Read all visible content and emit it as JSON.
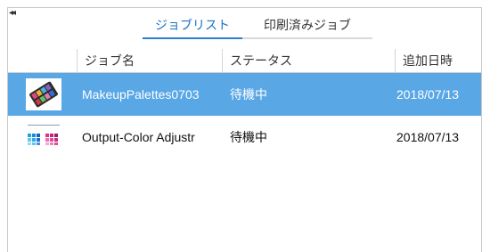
{
  "panel": {
    "collapse_glyph": "◂◂"
  },
  "tabs": [
    {
      "label": "ジョブリスト",
      "active": true
    },
    {
      "label": "印刷済みジョブ",
      "active": false
    }
  ],
  "table": {
    "columns": [
      "",
      "ジョブ名",
      "ステータス",
      "追加日時"
    ],
    "rows": [
      {
        "thumbnail_icon": "makeup-palette-thumbnail",
        "name": "MakeupPalettes0703",
        "status": "待機中",
        "added": "2018/07/13",
        "selected": true
      },
      {
        "thumbnail_icon": "color-chart-thumbnail",
        "name": "Output-Color Adjustr",
        "status": "待機中",
        "added": "2018/07/13",
        "selected": false
      }
    ]
  },
  "colors": {
    "accent": "#2a7fd2",
    "selected_row": "#5aa7e6"
  }
}
